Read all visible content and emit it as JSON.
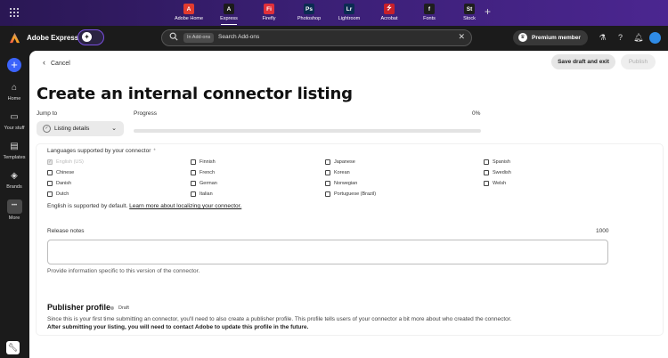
{
  "apps": [
    {
      "name": "Adobe Home",
      "glyph": "A",
      "color": "#e23b2e",
      "active": false
    },
    {
      "name": "Express",
      "glyph": "A",
      "color": "#1b1b1b",
      "active": true
    },
    {
      "name": "Firefly",
      "glyph": "Fi",
      "color": "#e0303a",
      "active": false
    },
    {
      "name": "Photoshop",
      "glyph": "Ps",
      "color": "#0b2b52",
      "active": false
    },
    {
      "name": "Lightroom",
      "glyph": "Lr",
      "color": "#0b2b52",
      "active": false
    },
    {
      "name": "Acrobat",
      "glyph": "⭍",
      "color": "#c8202a",
      "active": false
    },
    {
      "name": "Fonts",
      "glyph": "f",
      "color": "#1e1e1e",
      "active": false
    },
    {
      "name": "Stock",
      "glyph": "St",
      "color": "#1e1e1e",
      "active": false
    }
  ],
  "header": {
    "brand": "Adobe Express",
    "search_chip": "In Add-ons",
    "search_placeholder": "Search Add-ons",
    "premium_label": "Premium member"
  },
  "rail": {
    "items": [
      {
        "label": "Home",
        "icon": "home-icon"
      },
      {
        "label": "Your stuff",
        "icon": "folder-icon"
      },
      {
        "label": "Templates",
        "icon": "templates-icon"
      },
      {
        "label": "Brands",
        "icon": "brand-icon"
      },
      {
        "label": "More",
        "icon": "more-icon"
      }
    ]
  },
  "toolbar": {
    "cancel_label": "Cancel",
    "save_label": "Save draft and exit",
    "publish_label": "Publish"
  },
  "page": {
    "title": "Create an internal connector listing",
    "jump_label": "Jump to",
    "jump_value": "Listing details",
    "progress_label": "Progress",
    "progress_value": "0%",
    "progress_fraction": 0
  },
  "languages": {
    "label": "Languages supported by your connector",
    "required_mark": "*",
    "columns": [
      [
        {
          "name": "English (US)",
          "checked": true,
          "disabled": true
        },
        {
          "name": "Chinese",
          "checked": false,
          "disabled": false
        },
        {
          "name": "Danish",
          "checked": false,
          "disabled": false
        },
        {
          "name": "Dutch",
          "checked": false,
          "disabled": false
        }
      ],
      [
        {
          "name": "Finnish",
          "checked": false,
          "disabled": false
        },
        {
          "name": "French",
          "checked": false,
          "disabled": false
        },
        {
          "name": "German",
          "checked": false,
          "disabled": false
        },
        {
          "name": "Italian",
          "checked": false,
          "disabled": false
        }
      ],
      [
        {
          "name": "Japanese",
          "checked": false,
          "disabled": false
        },
        {
          "name": "Korean",
          "checked": false,
          "disabled": false
        },
        {
          "name": "Norwegian",
          "checked": false,
          "disabled": false
        },
        {
          "name": "Portuguese (Brazil)",
          "checked": false,
          "disabled": false
        }
      ],
      [
        {
          "name": "Spanish",
          "checked": false,
          "disabled": false
        },
        {
          "name": "Swedish",
          "checked": false,
          "disabled": false
        },
        {
          "name": "Welsh",
          "checked": false,
          "disabled": false
        }
      ]
    ],
    "note_text": "English is supported by default.",
    "note_link": "Learn more about localizing your connector."
  },
  "release_notes": {
    "label": "Release notes",
    "max_chars": "1000",
    "value": "",
    "help": "Provide information specific to this version of the connector."
  },
  "publisher": {
    "title": "Publisher profile",
    "badge": "Draft",
    "description": "Since this is your first time submitting an connector, you'll need to also create a publisher profile. This profile tells users of your connector a bit more about who created the connector.",
    "note": "After submitting your listing, you will need to contact Adobe to update this profile in the future."
  }
}
